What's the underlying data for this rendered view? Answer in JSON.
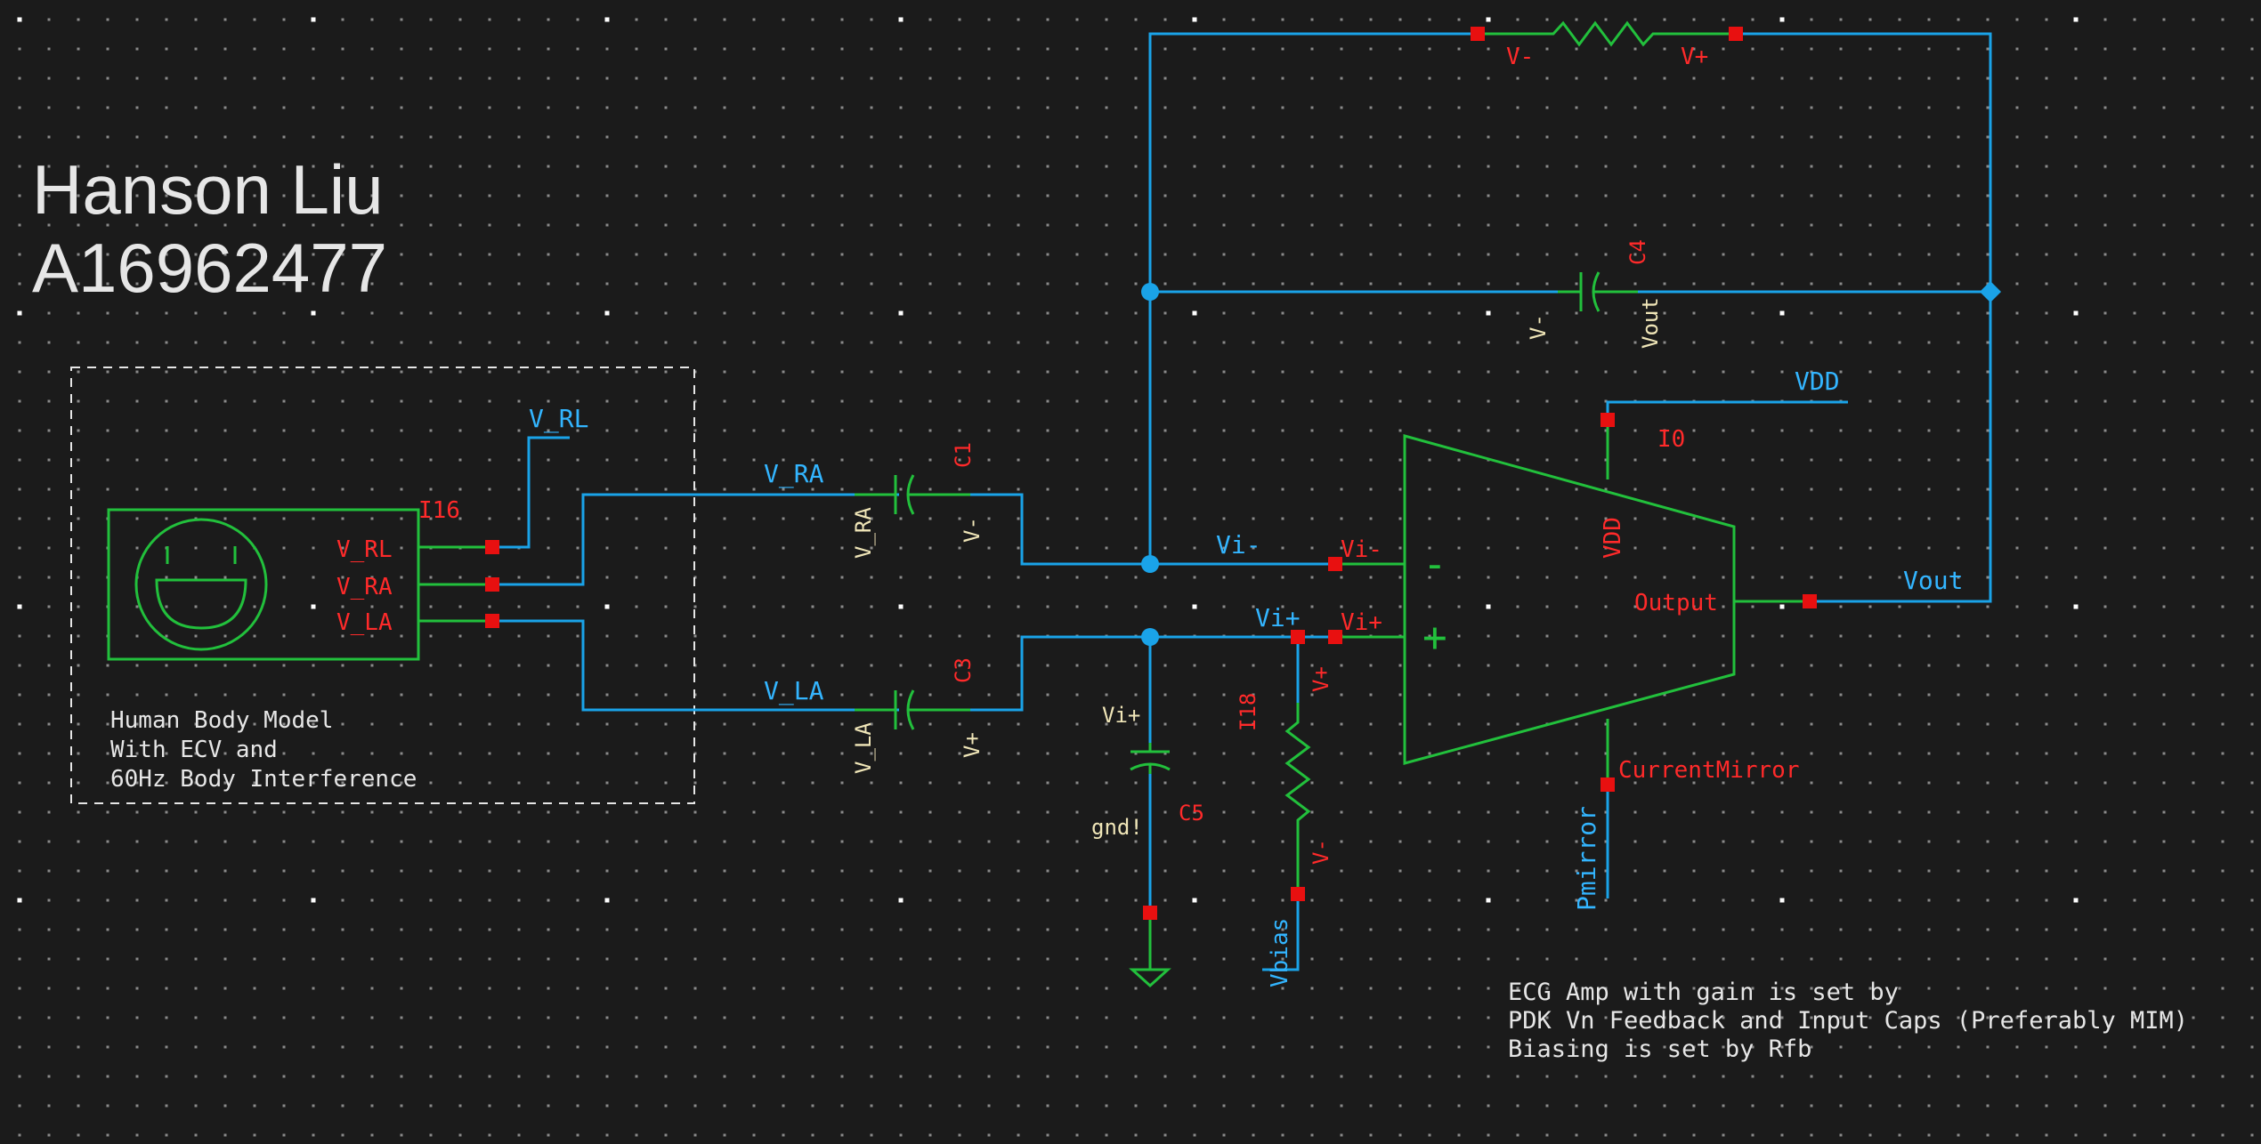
{
  "colors": {
    "background": "#1b1b1b",
    "grid_dot": "#8a8a8a",
    "grid_major": "#ffffff",
    "wire": "#1aa3e8",
    "symbol": "#22c03c",
    "pin": "#e81010",
    "label_red": "#ff2a2a",
    "label_blue": "#33b5ff",
    "label_white": "#e8e8e8",
    "label_yellow": "#f0e6b8",
    "text_white": "#e6e6e6"
  },
  "title": {
    "name": "Hanson Liu",
    "id": "A16962477"
  },
  "body_model": {
    "instance": "I16",
    "icon_name": "smiley-face-icon",
    "pins": [
      "V_RL",
      "V_RA",
      "V_LA"
    ],
    "description": [
      "Human Body Model",
      "With ECV and",
      "60Hz Body Interference"
    ]
  },
  "nets": {
    "v_rl": "V_RL",
    "v_ra": "V_RA",
    "v_la": "V_LA",
    "vi_minus": "Vi-",
    "vi_plus": "Vi+",
    "vdd": "VDD",
    "vout": "Vout",
    "pmirror": "Pmirror",
    "gnd": "gnd!",
    "vbias": "Vbias"
  },
  "components": {
    "c1": {
      "name": "C1",
      "pin_left": "V_RA",
      "pin_right": "V-"
    },
    "c3": {
      "name": "C3",
      "pin_left": "V_LA",
      "pin_right": "V+"
    },
    "c4": {
      "name": "C4",
      "pin_left": "V-",
      "pin_right": "Vout"
    },
    "c5": {
      "name": "C5",
      "pin_top": "Vi+",
      "pin_bottom": "gnd!"
    },
    "r_fb": {
      "pin_left": "V-",
      "pin_right": "V+"
    },
    "r_bias": {
      "name": "I18",
      "pin_top": "V+",
      "pin_bottom": "V-"
    },
    "opamp": {
      "name": "I0",
      "pin_inv": "Vi-",
      "pin_noninv": "Vi+",
      "pin_vdd": "VDD",
      "pin_out": "Output",
      "pin_mirror": "CurrentMirror",
      "minus_sign": "-",
      "plus_sign": "+"
    }
  },
  "notes": [
    "ECG Amp with gain is set by",
    "PDK Vn Feedback and Input Caps (Preferably MIM)",
    "Biasing is set by Rfb"
  ]
}
